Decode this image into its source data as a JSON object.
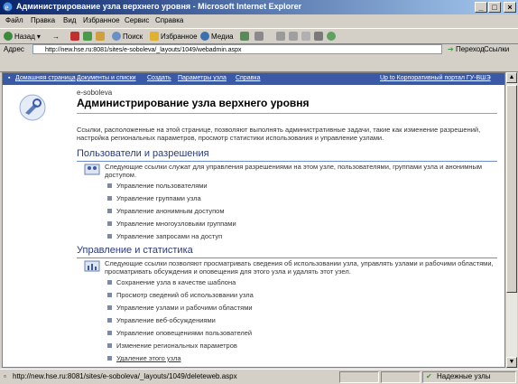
{
  "window": {
    "title": "Администрирование узла верхнего уровня - Microsoft Internet Explorer",
    "min": "_",
    "max": "□",
    "close": "×"
  },
  "menu": [
    "Файл",
    "Правка",
    "Вид",
    "Избранное",
    "Сервис",
    "Справка"
  ],
  "toolbar": {
    "back": "Назад",
    "search": "Поиск",
    "favorites": "Избранное",
    "media": "Медиа"
  },
  "address": {
    "label": "Адрес",
    "url": "http://new.hse.ru:8081/sites/e-soboleva/_layouts/1049/webadmin.aspx",
    "go": "Переход",
    "links": "Ссылки"
  },
  "nav": {
    "items": [
      "Домашняя страница",
      "Документы и списки",
      "Создать",
      "Параметры узла",
      "Справка"
    ],
    "right": "Up to Корпоративный портал ГУ-ВШЭ"
  },
  "page": {
    "site_name": "e-soboleva",
    "title": "Администрирование узла верхнего уровня",
    "description": "Ссылки, расположенные на этой странице, позволяют выполнять административные задачи, такие как изменение разрешений, настройка региональных параметров, просмотр статистики использования и управление узлами."
  },
  "sections": [
    {
      "title": "Пользователи и разрешения",
      "text": "Следующие ссылки служат для управления разрешениями на этом узле, пользователями, группами узла и анонимным доступом.",
      "links": [
        "Управление пользователями",
        "Управление группами узла",
        "Управление анонимным доступом",
        "Управление многоузловыми группами",
        "Управление запросами на доступ"
      ]
    },
    {
      "title": "Управление и статистика",
      "text": "Следующие ссылки позволяют просматривать сведения об использовании узла, управлять узлами и рабочими областями, просматривать обсуждения и оповещения для этого узла и удалять этот узел.",
      "links": [
        "Сохранение узла в качестве шаблона",
        "Просмотр сведений об использовании узла",
        "Управление узлами и рабочими областями",
        "Управление веб-обсуждениями",
        "Управление оповещениями пользователей",
        "Изменение региональных параметров",
        "Удаление этого узла"
      ]
    }
  ],
  "status": {
    "url": "http://new.hse.ru:8081/sites/e-soboleva/_layouts/1049/deleteweb.aspx",
    "zone": "Надежные узлы"
  },
  "colors": {
    "accent": "#3a5aa8",
    "title_bar": "#0a246a"
  }
}
